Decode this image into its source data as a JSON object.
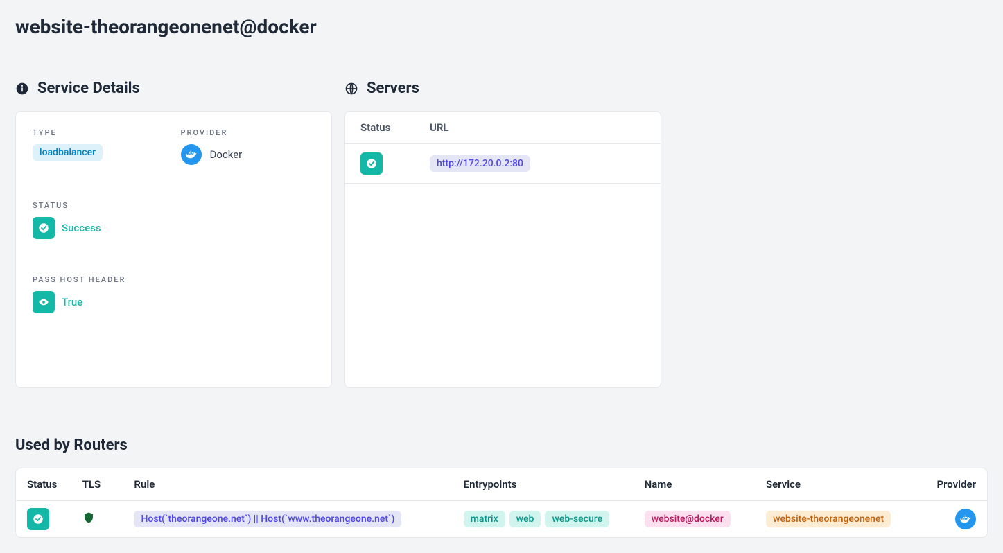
{
  "page": {
    "title": "website-theorangeonenet@docker"
  },
  "sections": {
    "service_details_title": "Service Details",
    "servers_title": "Servers",
    "used_by_title": "Used by Routers"
  },
  "details": {
    "type_label": "TYPE",
    "type_value": "loadbalancer",
    "provider_label": "PROVIDER",
    "provider_value": "Docker",
    "status_label": "STATUS",
    "status_value": "Success",
    "pass_host_header_label": "PASS HOST HEADER",
    "pass_host_header_value": "True"
  },
  "servers": {
    "header_status": "Status",
    "header_url": "URL",
    "rows": [
      {
        "url": "http://172.20.0.2:80"
      }
    ]
  },
  "routers": {
    "header_status": "Status",
    "header_tls": "TLS",
    "header_rule": "Rule",
    "header_entrypoints": "Entrypoints",
    "header_name": "Name",
    "header_service": "Service",
    "header_provider": "Provider",
    "rows": [
      {
        "rule": "Host(`theorangeone.net`) || Host(`www.theorangeone.net`)",
        "entrypoints": [
          "matrix",
          "web",
          "web-secure"
        ],
        "name": "website@docker",
        "service": "website-theorangeonenet"
      }
    ]
  }
}
